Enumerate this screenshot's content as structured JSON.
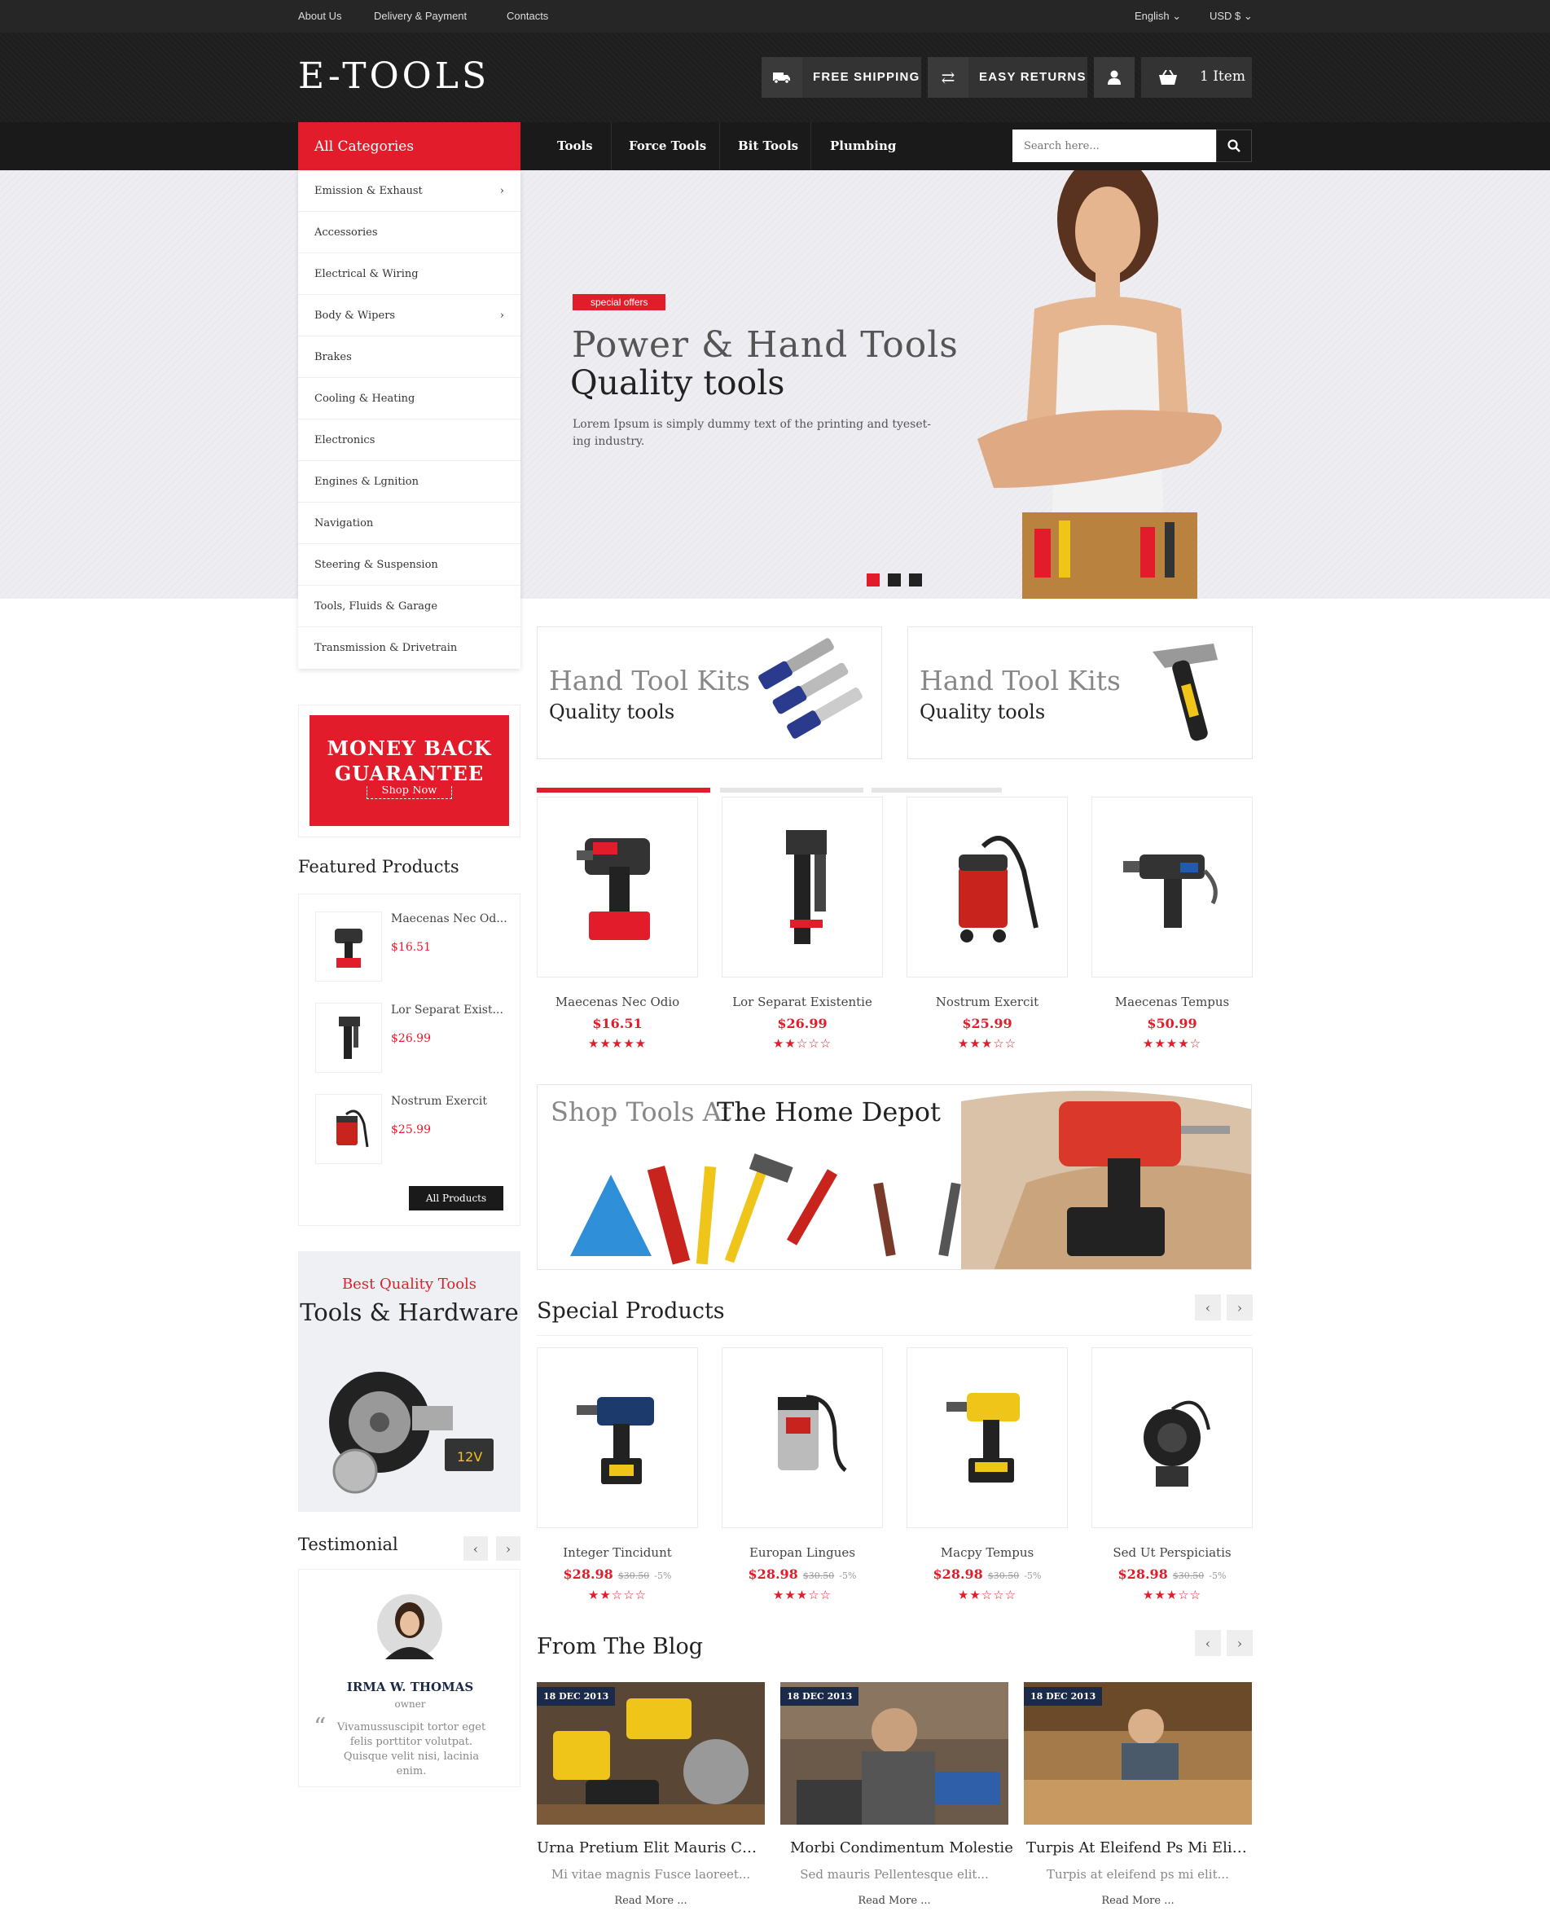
{
  "topbar": {
    "links": [
      "About Us",
      "Delivery & Payment",
      "Contacts"
    ],
    "language": "English",
    "currency": "USD $"
  },
  "header": {
    "logo": "E-TOOLS",
    "shipping": "FREE SHIPPING",
    "returns": "EASY RETURNS",
    "cart": "1 Item"
  },
  "nav": {
    "all_categories": "All Categories",
    "items": [
      "Tools",
      "Force Tools",
      "Bit Tools",
      "Plumbing"
    ],
    "search_placeholder": "Search here..."
  },
  "categories": [
    "Emission & Exhaust",
    "Accessories",
    "Electrical & Wiring",
    "Body & Wipers",
    "Brakes",
    "Cooling & Heating",
    "Electronics",
    "Engines & Lgnition",
    "Navigation",
    "Steering & Suspension",
    "Tools, Fluids & Garage",
    "Transmission & Drivetrain"
  ],
  "hero": {
    "badge": "special offers",
    "title": "Power & Hand Tools",
    "subtitle": "Quality tools",
    "text": "Lorem Ipsum is simply dummy text of the printing and tyeset-ing industry.",
    "slides_count": 3
  },
  "tool_banners": [
    {
      "title": "Hand Tool Kits",
      "subtitle": "Quality tools"
    },
    {
      "title": "Hand Tool Kits",
      "subtitle": "Quality tools"
    }
  ],
  "money_back": {
    "line1": "MONEY BACK",
    "line2": "GUARANTEE",
    "button": "Shop Now"
  },
  "featured": {
    "title": "Featured Products",
    "items": [
      {
        "name": "Maecenas Nec Od...",
        "price": "$16.51"
      },
      {
        "name": "Lor Separat Exist...",
        "price": "$26.99"
      },
      {
        "name": "Nostrum Exercit",
        "price": "$25.99"
      }
    ],
    "button": "All Products"
  },
  "products": [
    {
      "name": "Maecenas Nec Odio",
      "price": "$16.51",
      "rating": 5
    },
    {
      "name": "Lor Separat Existentie",
      "price": "$26.99",
      "rating": 2
    },
    {
      "name": "Nostrum Exercit",
      "price": "$25.99",
      "rating": 3
    },
    {
      "name": "Maecenas Tempus",
      "price": "$50.99",
      "rating": 4
    }
  ],
  "home_depot": {
    "light": "Shop Tools At",
    "bold": "The Home Depot"
  },
  "promo": {
    "small": "Best Quality Tools",
    "big": "Tools & Hardware"
  },
  "special": {
    "title": "Special Products",
    "items": [
      {
        "name": "Integer Tincidunt",
        "price": "$28.98",
        "old": "$30.50",
        "disc": "-5%",
        "rating": 2
      },
      {
        "name": "Europan Lingues",
        "price": "$28.98",
        "old": "$30.50",
        "disc": "-5%",
        "rating": 3
      },
      {
        "name": "Macpy Tempus",
        "price": "$28.98",
        "old": "$30.50",
        "disc": "-5%",
        "rating": 2
      },
      {
        "name": "Sed Ut Perspiciatis",
        "price": "$28.98",
        "old": "$30.50",
        "disc": "-5%",
        "rating": 3
      }
    ]
  },
  "testimonial": {
    "title": "Testimonial",
    "name": "IRMA W. THOMAS",
    "role": "owner",
    "quote": "Vivamussuscipit tortor eget felis porttitor volutpat. Quisque velit nisi, lacinia enim."
  },
  "blog": {
    "title": "From The Blog",
    "posts": [
      {
        "date": "18 DEC 2013",
        "title": "Urna Pretium Elit Mauris Cursus",
        "excerpt": "Mi vitae magnis Fusce laoreet...",
        "more": "Read More ..."
      },
      {
        "date": "18 DEC 2013",
        "title": "Morbi Condimentum Molestie",
        "excerpt": "Sed mauris Pellentesque elit...",
        "more": "Read More ..."
      },
      {
        "date": "18 DEC 2013",
        "title": "Turpis At Eleifend Ps Mi Elit Aliquam",
        "excerpt": "Turpis at eleifend ps mi elit...",
        "more": "Read More ..."
      }
    ]
  },
  "colors": {
    "accent": "#e21c2b",
    "dark": "#1e1e1e",
    "navy": "#1c2a4a"
  }
}
